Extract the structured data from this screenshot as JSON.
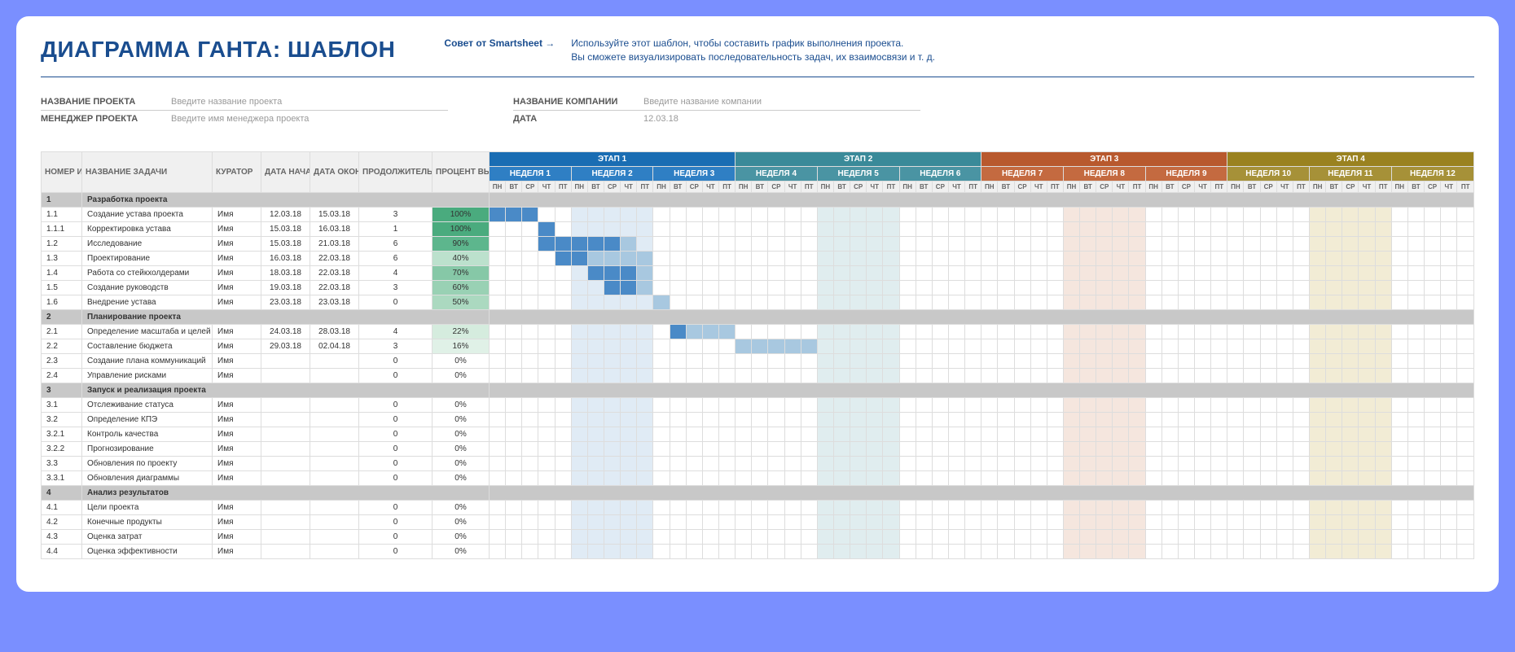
{
  "title": "ДИАГРАММА ГАНТА: ШАБЛОН",
  "tip": {
    "label": "Совет от Smartsheet →",
    "text1": "Используйте этот шаблон, чтобы составить график выполнения проекта.",
    "text2": "Вы сможете визуализировать последовательность задач, их взаимосвязи и т. д."
  },
  "meta": {
    "left": [
      {
        "label": "НАЗВАНИЕ ПРОЕКТА",
        "value": "Введите название проекта"
      },
      {
        "label": "МЕНЕДЖЕР ПРОЕКТА",
        "value": "Введите имя менеджера проекта"
      }
    ],
    "right": [
      {
        "label": "НАЗВАНИЕ КОМПАНИИ",
        "value": "Введите название компании"
      },
      {
        "label": "ДАТА",
        "value": "12.03.18"
      }
    ]
  },
  "columns": {
    "id": "НОМЕР ИСР",
    "task": "НАЗВАНИЕ ЗАДАЧИ",
    "curator": "КУРАТОР",
    "start": "ДАТА НАЧАЛА",
    "end": "ДАТА ОКОНЧАНИЯ",
    "dur": "ПРОДОЛЖИТЕЛЬНОСТЬ",
    "pct": "ПРОЦЕНТ ВЫПОЛНЕНИЯ"
  },
  "stages": [
    "ЭТАП 1",
    "ЭТАП 2",
    "ЭТАП 3",
    "ЭТАП 4"
  ],
  "weeks": [
    "НЕДЕЛЯ 1",
    "НЕДЕЛЯ 2",
    "НЕДЕЛЯ 3",
    "НЕДЕЛЯ 4",
    "НЕДЕЛЯ 5",
    "НЕДЕЛЯ 6",
    "НЕДЕЛЯ 7",
    "НЕДЕЛЯ 8",
    "НЕДЕЛЯ 9",
    "НЕДЕЛЯ 10",
    "НЕДЕЛЯ 11",
    "НЕДЕЛЯ 12"
  ],
  "days": [
    "ПН",
    "ВТ",
    "СР",
    "ЧТ",
    "ПТ"
  ],
  "rows": [
    {
      "type": "section",
      "id": "1",
      "task": "Разработка проекта"
    },
    {
      "id": "1.1",
      "task": "Создание устава проекта",
      "cur": "Имя",
      "ds": "12.03.18",
      "de": "15.03.18",
      "dur": "3",
      "pct": "100%",
      "pcls": "pct100",
      "bars": [
        [
          0,
          3,
          "d"
        ]
      ]
    },
    {
      "id": "1.1.1",
      "task": "Корректировка устава",
      "cur": "Имя",
      "ds": "15.03.18",
      "de": "16.03.18",
      "dur": "1",
      "pct": "100%",
      "pcls": "pct100",
      "bars": [
        [
          3,
          1,
          "d"
        ]
      ]
    },
    {
      "id": "1.2",
      "task": "Исследование",
      "cur": "Имя",
      "ds": "15.03.18",
      "de": "21.03.18",
      "dur": "6",
      "pct": "90%",
      "pcls": "pct90",
      "bars": [
        [
          3,
          5,
          "d"
        ],
        [
          8,
          1,
          "l"
        ]
      ]
    },
    {
      "id": "1.3",
      "task": "Проектирование",
      "cur": "Имя",
      "ds": "16.03.18",
      "de": "22.03.18",
      "dur": "6",
      "pct": "40%",
      "pcls": "pct40",
      "bars": [
        [
          4,
          2,
          "d"
        ],
        [
          6,
          4,
          "l"
        ]
      ]
    },
    {
      "id": "1.4",
      "task": "Работа со стейкхолдерами",
      "cur": "Имя",
      "ds": "18.03.18",
      "de": "22.03.18",
      "dur": "4",
      "pct": "70%",
      "pcls": "pct70",
      "bars": [
        [
          6,
          3,
          "d"
        ],
        [
          9,
          1,
          "l"
        ]
      ]
    },
    {
      "id": "1.5",
      "task": "Создание руководств",
      "cur": "Имя",
      "ds": "19.03.18",
      "de": "22.03.18",
      "dur": "3",
      "pct": "60%",
      "pcls": "pct60",
      "bars": [
        [
          7,
          2,
          "d"
        ],
        [
          9,
          1,
          "l"
        ]
      ]
    },
    {
      "id": "1.6",
      "task": "Внедрение устава",
      "cur": "Имя",
      "ds": "23.03.18",
      "de": "23.03.18",
      "dur": "0",
      "pct": "50%",
      "pcls": "pct50",
      "bars": [
        [
          10,
          1,
          "l"
        ]
      ]
    },
    {
      "type": "section",
      "id": "2",
      "task": "Планирование проекта"
    },
    {
      "id": "2.1",
      "task": "Определение масштаба и целей",
      "cur": "Имя",
      "ds": "24.03.18",
      "de": "28.03.18",
      "dur": "4",
      "pct": "22%",
      "pcls": "pct22",
      "bars": [
        [
          11,
          1,
          "d"
        ],
        [
          12,
          3,
          "l"
        ]
      ]
    },
    {
      "id": "2.2",
      "task": "Составление бюджета",
      "cur": "Имя",
      "ds": "29.03.18",
      "de": "02.04.18",
      "dur": "3",
      "pct": "16%",
      "pcls": "pct16",
      "bars": [
        [
          15,
          2,
          "l"
        ],
        [
          17,
          3,
          "l"
        ]
      ]
    },
    {
      "id": "2.3",
      "task": "Создание плана коммуникаций",
      "cur": "Имя",
      "ds": "",
      "de": "",
      "dur": "0",
      "pct": "0%"
    },
    {
      "id": "2.4",
      "task": "Управление рисками",
      "cur": "Имя",
      "ds": "",
      "de": "",
      "dur": "0",
      "pct": "0%"
    },
    {
      "type": "section",
      "id": "3",
      "task": "Запуск и реализация проекта"
    },
    {
      "id": "3.1",
      "task": "Отслеживание статуса",
      "cur": "Имя",
      "ds": "",
      "de": "",
      "dur": "0",
      "pct": "0%"
    },
    {
      "id": "3.2",
      "task": "Определение КПЭ",
      "cur": "Имя",
      "ds": "",
      "de": "",
      "dur": "0",
      "pct": "0%"
    },
    {
      "id": "3.2.1",
      "task": "Контроль качества",
      "cur": "Имя",
      "ds": "",
      "de": "",
      "dur": "0",
      "pct": "0%"
    },
    {
      "id": "3.2.2",
      "task": "Прогнозирование",
      "cur": "Имя",
      "ds": "",
      "de": "",
      "dur": "0",
      "pct": "0%"
    },
    {
      "id": "3.3",
      "task": "Обновления по проекту",
      "cur": "Имя",
      "ds": "",
      "de": "",
      "dur": "0",
      "pct": "0%"
    },
    {
      "id": "3.3.1",
      "task": "Обновления диаграммы",
      "cur": "Имя",
      "ds": "",
      "de": "",
      "dur": "0",
      "pct": "0%"
    },
    {
      "type": "section",
      "id": "4",
      "task": "Анализ результатов"
    },
    {
      "id": "4.1",
      "task": "Цели проекта",
      "cur": "Имя",
      "ds": "",
      "de": "",
      "dur": "0",
      "pct": "0%"
    },
    {
      "id": "4.2",
      "task": "Конечные продукты",
      "cur": "Имя",
      "ds": "",
      "de": "",
      "dur": "0",
      "pct": "0%"
    },
    {
      "id": "4.3",
      "task": "Оценка затрат",
      "cur": "Имя",
      "ds": "",
      "de": "",
      "dur": "0",
      "pct": "0%"
    },
    {
      "id": "4.4",
      "task": "Оценка эффективности",
      "cur": "Имя",
      "ds": "",
      "de": "",
      "dur": "0",
      "pct": "0%"
    }
  ]
}
